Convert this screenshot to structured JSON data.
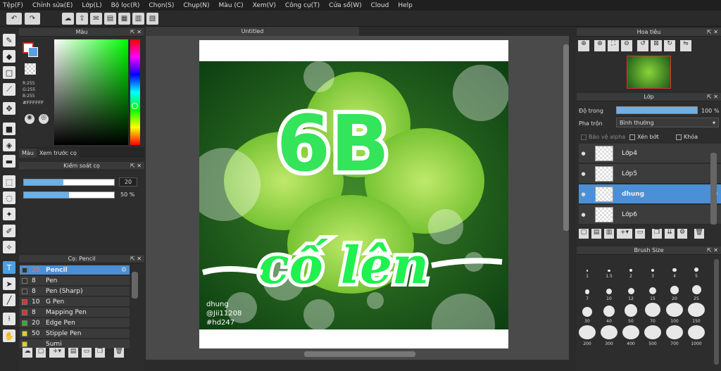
{
  "menu": [
    "Tệp(F)",
    "Chỉnh sửa(E)",
    "Lớp(L)",
    "Bộ lọc(R)",
    "Chọn(S)",
    "Chụp(N)",
    "Màu (C)",
    "Xem(V)",
    "Công cụ(T)",
    "Cửa sổ(W)",
    "Cloud",
    "Help"
  ],
  "color_panel": {
    "title": "Màu",
    "r": "R:255",
    "g": "G:255",
    "b": "B:255",
    "hex": "#FFFFFF",
    "tab_color": "Màu",
    "tab_preview": "Xem trước cọ"
  },
  "brush_control": {
    "title": "Kiểm soát cọ",
    "size": "20",
    "opacity": "50 %",
    "size_fill": 0.44,
    "opacity_fill": 0.5
  },
  "brush_list": {
    "title": "Cọ: Pencil",
    "items": [
      {
        "num": "20",
        "name": "Pencil",
        "color": "#333333",
        "selected": true
      },
      {
        "num": "8",
        "name": "Pen",
        "color": "#333333"
      },
      {
        "num": "8",
        "name": "Pen (Sharp)",
        "color": "#333333"
      },
      {
        "num": "10",
        "name": "G Pen",
        "color": "#e03030"
      },
      {
        "num": "8",
        "name": "Mapping Pen",
        "color": "#e03030"
      },
      {
        "num": "20",
        "name": "Edge Pen",
        "color": "#30b030"
      },
      {
        "num": "50",
        "name": "Stipple Pen",
        "color": "#e0d020"
      },
      {
        "num": "",
        "name": "Sumi",
        "color": "#e0d020"
      }
    ]
  },
  "document": {
    "tab": "Untitled"
  },
  "artwork": {
    "line1": "6B",
    "line2": "cố lên",
    "credit1": "dhung",
    "credit2": "@Jii11208",
    "credit3": "#hd247"
  },
  "navigator": {
    "title": "Hoa tiêu"
  },
  "layers": {
    "title": "Lớp",
    "opacity_label": "Độ trong",
    "opacity_value": "100 %",
    "opacity_level": 1.0,
    "blend_label": "Pha trộn",
    "blend_value": "Bình thường",
    "protect_alpha": "Bảo vệ alpha",
    "clipping": "Xén bớt",
    "lock": "Khóa",
    "items": [
      {
        "name": "Lớp4"
      },
      {
        "name": "Lớp5"
      },
      {
        "name": "dhung",
        "selected": true
      },
      {
        "name": "Lớp6"
      }
    ]
  },
  "brush_size": {
    "title": "Brush Size",
    "sizes": [
      "1",
      "1.5",
      "2",
      "3",
      "4",
      "5",
      "7",
      "10",
      "12",
      "15",
      "20",
      "25",
      "30",
      "40",
      "50",
      "70",
      "100",
      "150",
      "200",
      "300",
      "400",
      "500",
      "700",
      "1000"
    ]
  },
  "colors": {
    "accent": "#4b8fd6",
    "green": "#2fe055",
    "leaf": "#8ad43a"
  }
}
